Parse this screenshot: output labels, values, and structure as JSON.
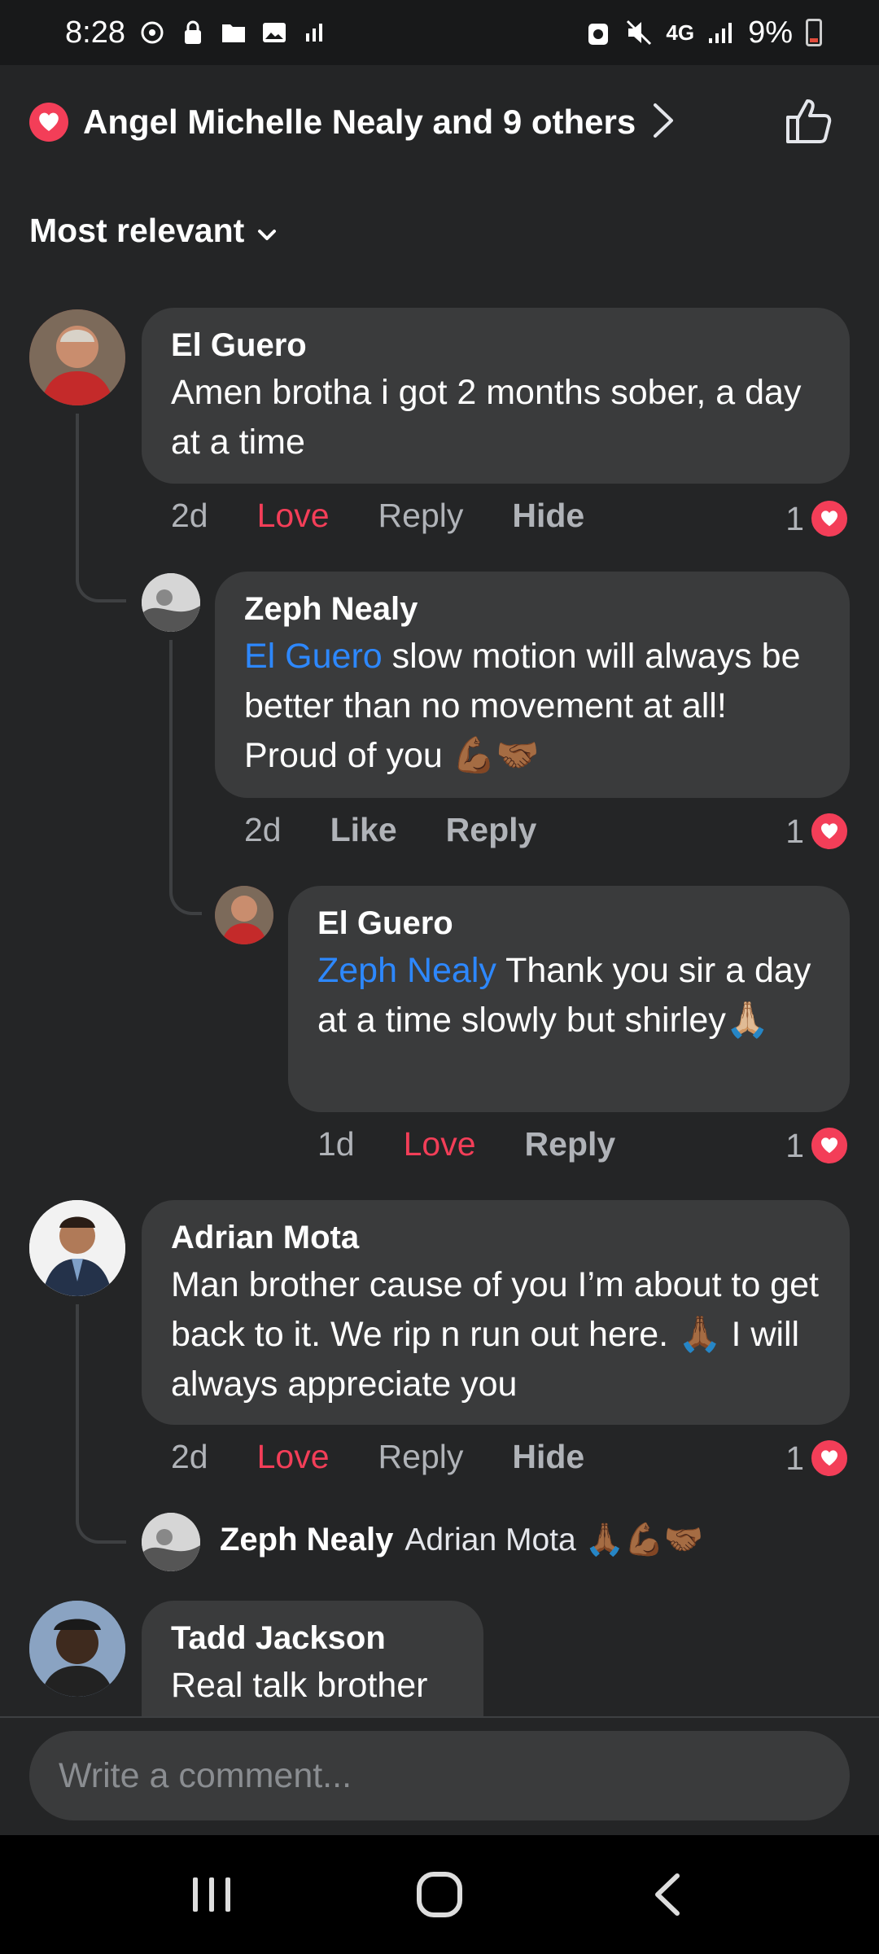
{
  "status_bar": {
    "time": "8:28",
    "battery_percent": "9%",
    "network": "4G"
  },
  "header": {
    "reactors_text": "Angel Michelle Nealy and 9 others",
    "reaction_icon": "heart-icon",
    "like_icon": "thumbs-up-icon"
  },
  "sort": {
    "label": "Most relevant"
  },
  "comments": [
    {
      "author": "El Guero",
      "text": "Amen brotha i got 2 months sober, a day at a time",
      "time": "2d",
      "reaction_label": "Love",
      "reply_label": "Reply",
      "hide_label": "Hide",
      "reaction_count": "1",
      "replies": [
        {
          "author": "Zeph Nealy",
          "mention": "El Guero",
          "text": " slow motion will always be better than no movement at all! Proud of you 💪🏾🤝🏾",
          "time": "2d",
          "reaction_label": "Like",
          "reply_label": "Reply",
          "reaction_count": "1"
        },
        {
          "author": "El Guero",
          "mention": "Zeph Nealy",
          "text": " Thank you sir a day at a time slowly but shirley🙏🏼",
          "time": "1d",
          "reaction_label": "Love",
          "reply_label": "Reply",
          "reaction_count": "1"
        }
      ]
    },
    {
      "author": "Adrian Mota",
      "text": "Man brother cause of you I’m about to get back to it. We rip n run out here. 🙏🏾 I will always appreciate you",
      "time": "2d",
      "reaction_label": "Love",
      "reply_label": "Reply",
      "hide_label": "Hide",
      "reaction_count": "1",
      "collapsed_reply": {
        "author": "Zeph Nealy",
        "preview": "Adrian Mota 🙏🏾💪🏾🤝🏾"
      }
    },
    {
      "author": "Tadd Jackson",
      "text": "Real talk brother"
    }
  ],
  "composer": {
    "placeholder": "Write a comment..."
  },
  "colors": {
    "background": "#242526",
    "bubble": "#3a3b3c",
    "love": "#f33e58",
    "mention": "#2d88ff"
  }
}
